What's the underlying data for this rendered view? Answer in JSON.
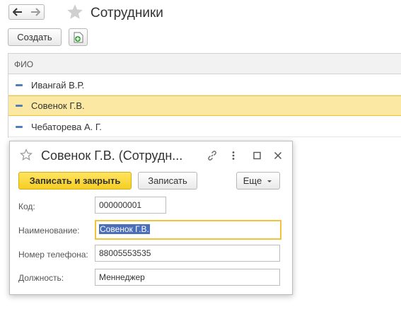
{
  "window": {
    "title": "Сотрудники",
    "back_icon": "arrow-left-icon",
    "forward_icon": "arrow-right-icon",
    "favorite_icon": "star-icon"
  },
  "toolbar": {
    "create_label": "Создать",
    "add_icon": "add-document-icon"
  },
  "list": {
    "column_header": "ФИО",
    "rows": [
      {
        "name": "Ивангай В.Р.",
        "selected": false
      },
      {
        "name": "Совенок Г.В.",
        "selected": true
      },
      {
        "name": "Чебаторева А. Г.",
        "selected": false
      }
    ]
  },
  "dialog": {
    "title": "Совенок Г.В. (Сотрудн...",
    "icons": [
      "star-icon",
      "link-icon",
      "more-vertical-icon",
      "maximize-icon",
      "close-icon"
    ],
    "save_close_label": "Записать и закрыть",
    "save_label": "Записать",
    "more_label": "Еще",
    "fields": {
      "code": {
        "label": "Код:",
        "value": "000000001"
      },
      "name": {
        "label": "Наименование:",
        "value": "Совенок Г.В."
      },
      "phone": {
        "label": "Номер телефона:",
        "value": "88005553535"
      },
      "position": {
        "label": "Должность:",
        "value": "Меннеджер"
      }
    }
  },
  "colors": {
    "accent_yellow": "#f6cf24",
    "selection_bg": "#fbe9a3",
    "selection_border": "#f0c33a",
    "text_highlight": "#4a6fb8"
  }
}
